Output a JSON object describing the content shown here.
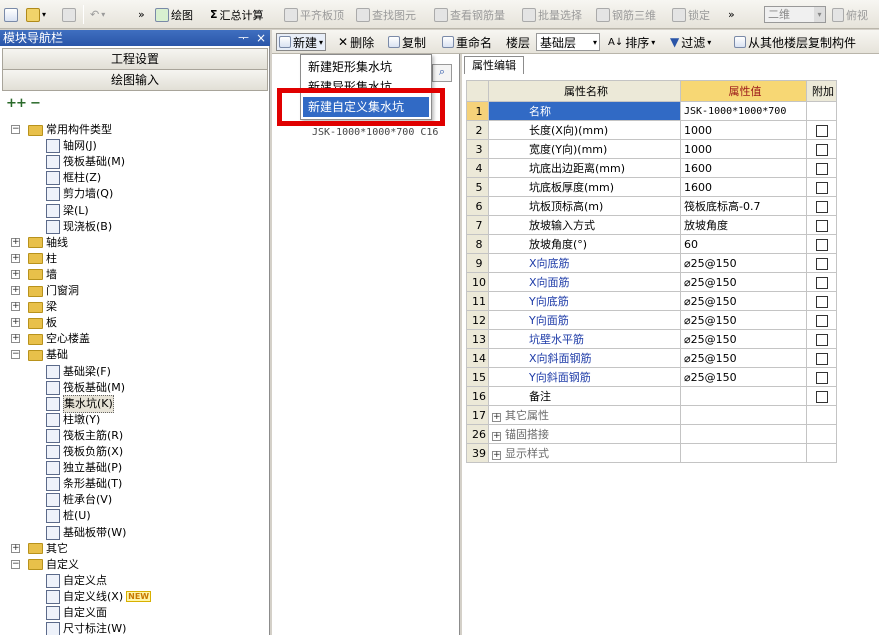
{
  "toolbar": {
    "draw": "绘图",
    "sum": "汇总计算",
    "flat": "平齐板顶",
    "find": "查找图元",
    "view_rebar": "查看钢筋量",
    "batch": "批量选择",
    "rebar3d": "钢筋三维",
    "lock": "锁定",
    "view_mode": "二维",
    "top_view": "俯视"
  },
  "left": {
    "title": "模块导航栏",
    "pin": "ᅮ",
    "close": "×",
    "btn_project": "工程设置",
    "btn_draw": "绘图输入",
    "tree": [
      {
        "label": "常用构件类型",
        "type": "folder",
        "level": 0,
        "expanded": true
      },
      {
        "label": "轴网(J)",
        "type": "item",
        "level": 1
      },
      {
        "label": "筏板基础(M)",
        "type": "item",
        "level": 1
      },
      {
        "label": "框柱(Z)",
        "type": "item",
        "level": 1
      },
      {
        "label": "剪力墙(Q)",
        "type": "item",
        "level": 1
      },
      {
        "label": "梁(L)",
        "type": "item",
        "level": 1
      },
      {
        "label": "现浇板(B)",
        "type": "item",
        "level": 1
      },
      {
        "label": "轴线",
        "type": "folder",
        "level": 0,
        "expanded": false
      },
      {
        "label": "柱",
        "type": "folder",
        "level": 0,
        "expanded": false
      },
      {
        "label": "墙",
        "type": "folder",
        "level": 0,
        "expanded": false
      },
      {
        "label": "门窗洞",
        "type": "folder",
        "level": 0,
        "expanded": false
      },
      {
        "label": "梁",
        "type": "folder",
        "level": 0,
        "expanded": false
      },
      {
        "label": "板",
        "type": "folder",
        "level": 0,
        "expanded": false
      },
      {
        "label": "空心楼盖",
        "type": "folder",
        "level": 0,
        "expanded": false
      },
      {
        "label": "基础",
        "type": "folder",
        "level": 0,
        "expanded": true
      },
      {
        "label": "基础梁(F)",
        "type": "item",
        "level": 1
      },
      {
        "label": "筏板基础(M)",
        "type": "item",
        "level": 1
      },
      {
        "label": "集水坑(K)",
        "type": "item",
        "level": 1,
        "selected": true
      },
      {
        "label": "柱墩(Y)",
        "type": "item",
        "level": 1
      },
      {
        "label": "筏板主筋(R)",
        "type": "item",
        "level": 1
      },
      {
        "label": "筏板负筋(X)",
        "type": "item",
        "level": 1
      },
      {
        "label": "独立基础(P)",
        "type": "item",
        "level": 1
      },
      {
        "label": "条形基础(T)",
        "type": "item",
        "level": 1
      },
      {
        "label": "桩承台(V)",
        "type": "item",
        "level": 1
      },
      {
        "label": "桩(U)",
        "type": "item",
        "level": 1
      },
      {
        "label": "基础板带(W)",
        "type": "item",
        "level": 1
      },
      {
        "label": "其它",
        "type": "folder",
        "level": 0,
        "expanded": false
      },
      {
        "label": "自定义",
        "type": "folder",
        "level": 0,
        "expanded": true
      },
      {
        "label": "自定义点",
        "type": "item",
        "level": 1
      },
      {
        "label": "自定义线(X)",
        "type": "item",
        "level": 1,
        "badge": "NEW"
      },
      {
        "label": "自定义面",
        "type": "item",
        "level": 1
      },
      {
        "label": "尺寸标注(W)",
        "type": "item",
        "level": 1
      }
    ]
  },
  "mid": {
    "new": "新建",
    "delete": "删除",
    "copy": "复制",
    "rename": "重命名",
    "floor_label": "楼层",
    "floor_value": "基础层",
    "sort": "排序",
    "filter": "过滤",
    "copy_from": "从其他楼层复制构件",
    "menu": [
      "新建矩形集水坑",
      "新建异形集水坑",
      "新建自定义集水坑"
    ],
    "list_item": "JSK-1000*1000*700 C16"
  },
  "props": {
    "tab": "属性编辑",
    "headers": [
      "属性名称",
      "属性值",
      "附加"
    ],
    "rows": [
      {
        "n": "1",
        "name": "名称",
        "value": "JSK-1000*1000*700",
        "blue": false,
        "cb": false
      },
      {
        "n": "2",
        "name": "长度(X向)(mm)",
        "value": "1000",
        "blue": false,
        "cb": true
      },
      {
        "n": "3",
        "name": "宽度(Y向)(mm)",
        "value": "1000",
        "blue": false,
        "cb": true
      },
      {
        "n": "4",
        "name": "坑底出边距离(mm)",
        "value": "1600",
        "blue": false,
        "cb": true
      },
      {
        "n": "5",
        "name": "坑底板厚度(mm)",
        "value": "1600",
        "blue": false,
        "cb": true
      },
      {
        "n": "6",
        "name": "坑板顶标高(m)",
        "value": "筏板底标高-0.7",
        "blue": false,
        "cb": true
      },
      {
        "n": "7",
        "name": "放坡输入方式",
        "value": "放坡角度",
        "blue": false,
        "cb": true
      },
      {
        "n": "8",
        "name": "放坡角度(°)",
        "value": "60",
        "blue": false,
        "cb": true
      },
      {
        "n": "9",
        "name": "X向底筋",
        "value": "⌀25@150",
        "blue": true,
        "cb": true
      },
      {
        "n": "10",
        "name": "X向面筋",
        "value": "⌀25@150",
        "blue": true,
        "cb": true
      },
      {
        "n": "11",
        "name": "Y向底筋",
        "value": "⌀25@150",
        "blue": true,
        "cb": true
      },
      {
        "n": "12",
        "name": "Y向面筋",
        "value": "⌀25@150",
        "blue": true,
        "cb": true
      },
      {
        "n": "13",
        "name": "坑壁水平筋",
        "value": "⌀25@150",
        "blue": true,
        "cb": true
      },
      {
        "n": "14",
        "name": "X向斜面钢筋",
        "value": "⌀25@150",
        "blue": true,
        "cb": true
      },
      {
        "n": "15",
        "name": "Y向斜面钢筋",
        "value": "⌀25@150",
        "blue": true,
        "cb": true
      },
      {
        "n": "16",
        "name": "备注",
        "value": "",
        "blue": false,
        "cb": true
      }
    ],
    "groups": [
      {
        "n": "17",
        "name": "其它属性"
      },
      {
        "n": "26",
        "name": "锚固搭接"
      },
      {
        "n": "39",
        "name": "显示样式"
      }
    ]
  }
}
